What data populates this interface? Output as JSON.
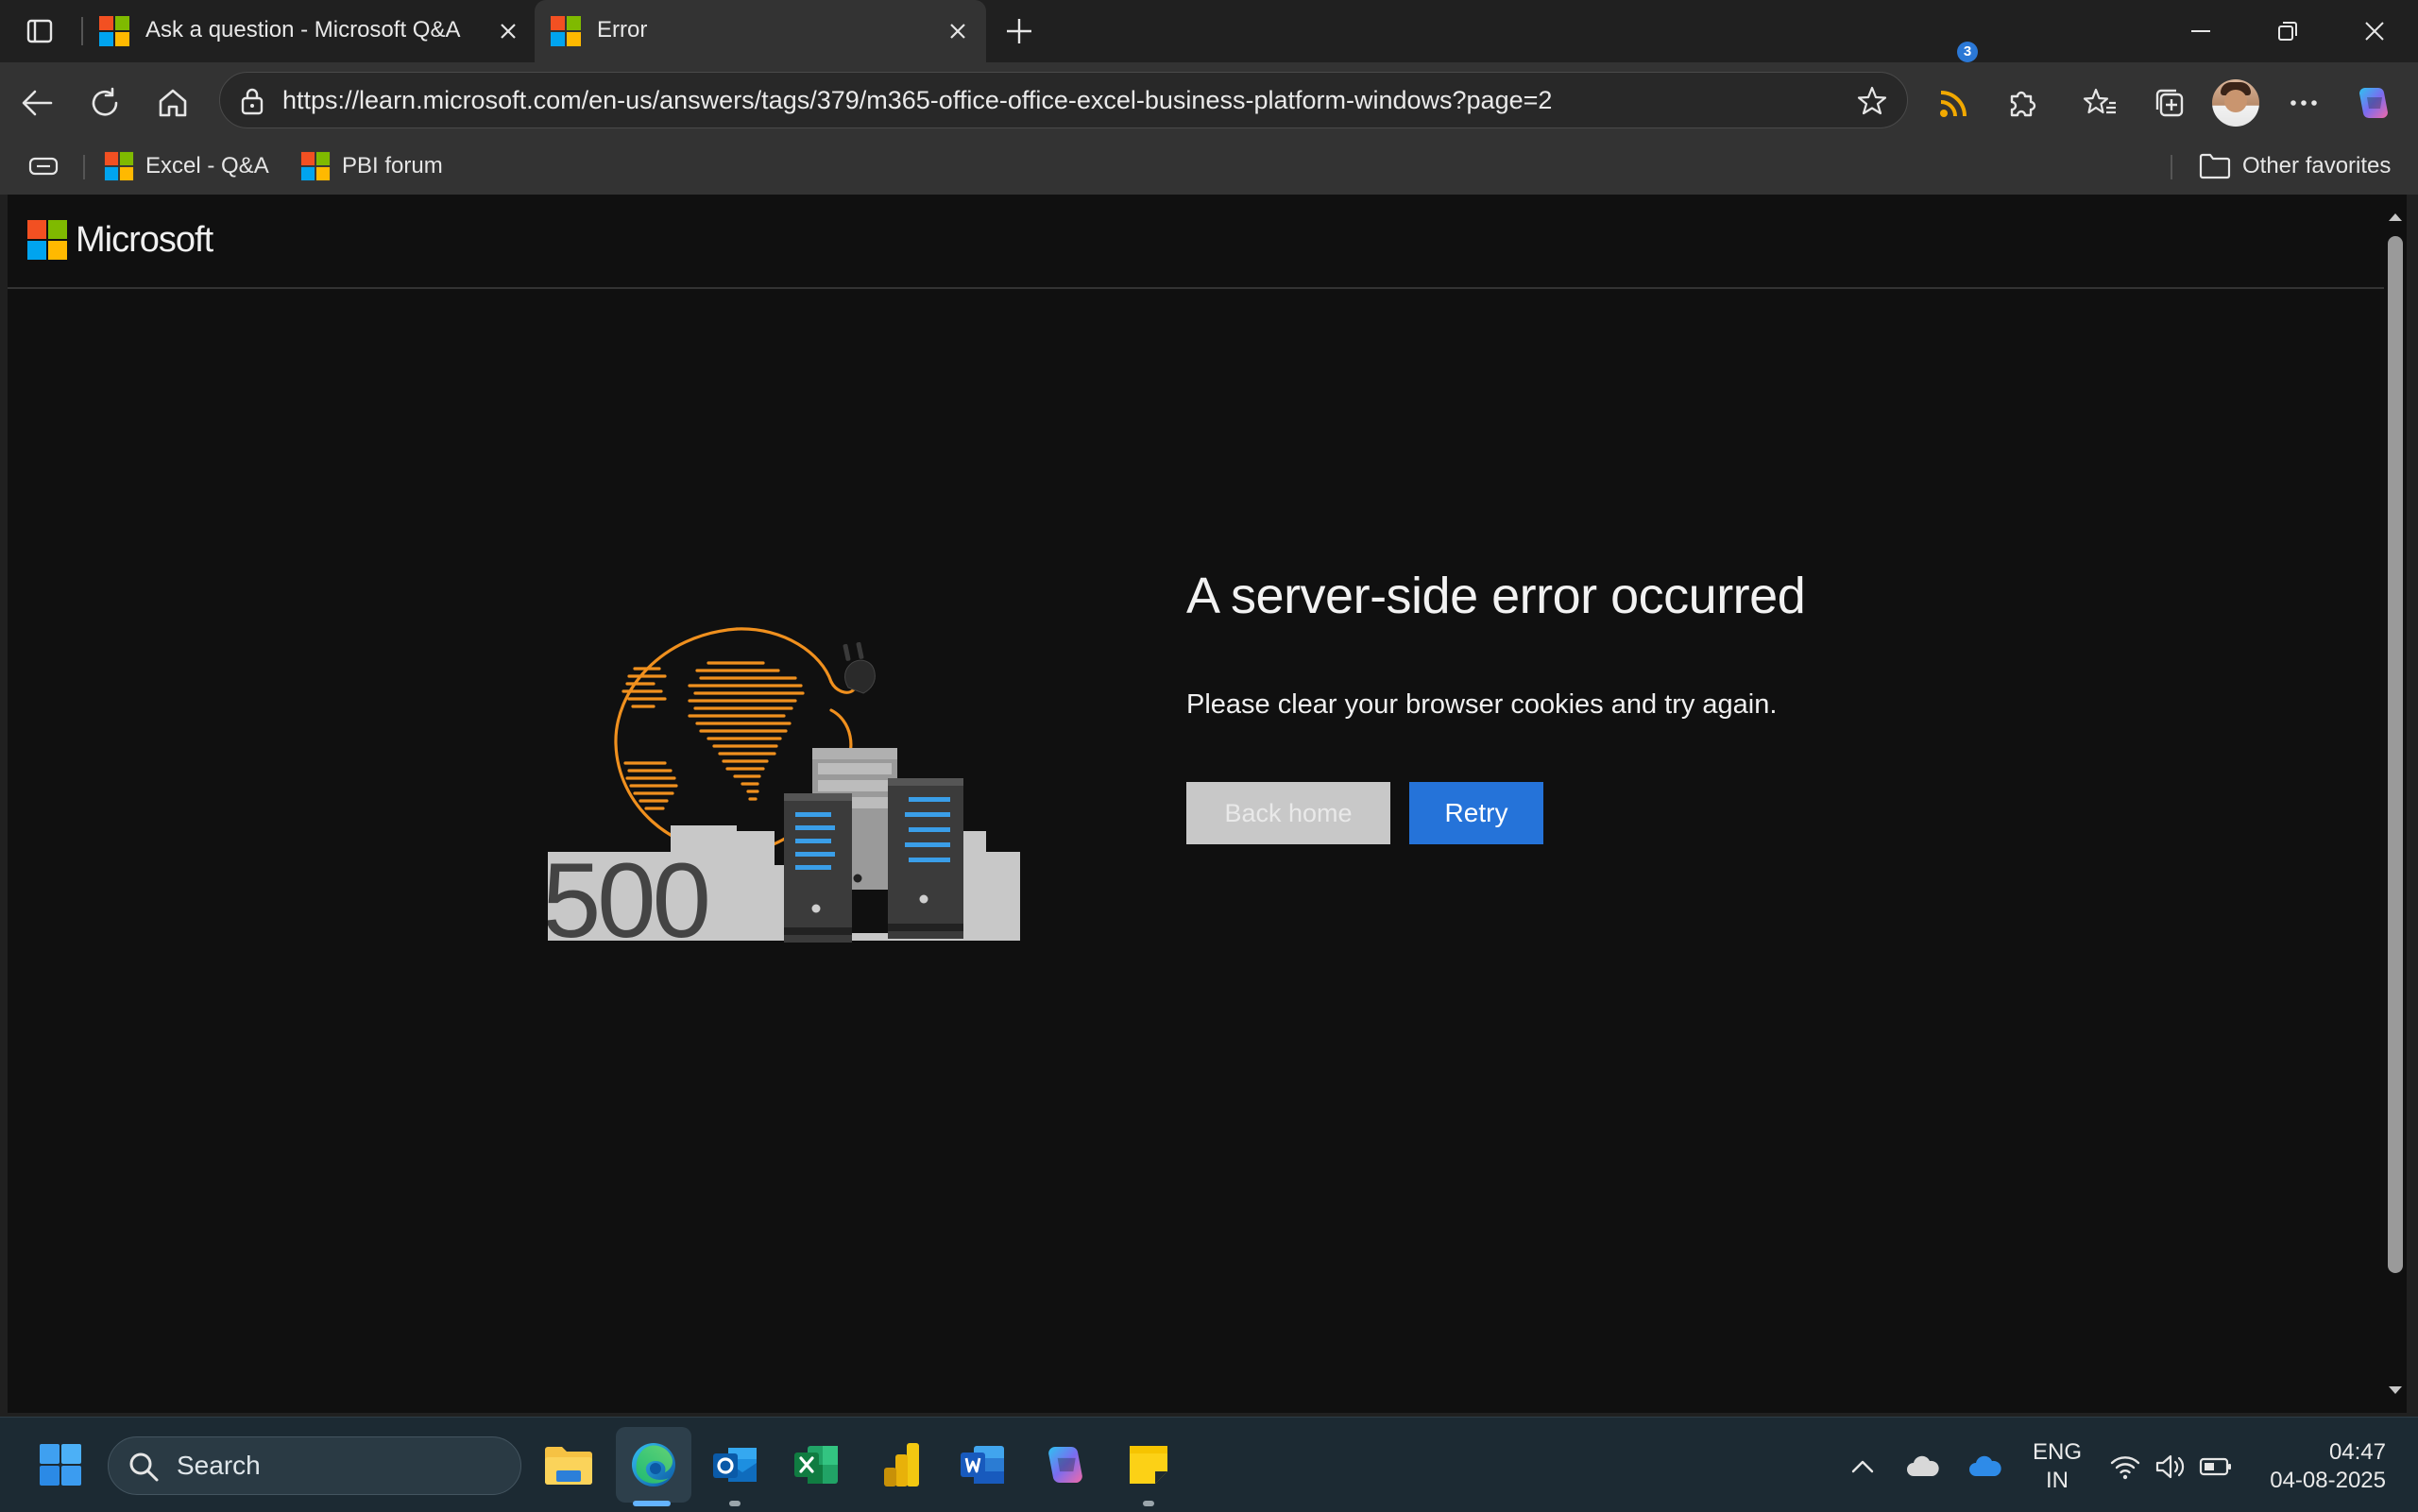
{
  "browser": {
    "tabs": [
      {
        "title": "Ask a question - Microsoft Q&A",
        "active": false
      },
      {
        "title": "Error",
        "active": true
      }
    ],
    "address_url": "https://learn.microsoft.com/en-us/answers/tags/379/m365-office-office-excel-business-platform-windows?page=2",
    "feed_badge_count": "3",
    "favorites": [
      {
        "label": "Excel - Q&A"
      },
      {
        "label": "PBI forum"
      }
    ],
    "other_favorites": "Other favorites"
  },
  "page": {
    "brand": "Microsoft",
    "illustration_code": "500",
    "title": "A server-side error occurred",
    "message": "Please clear your browser cookies and try again.",
    "back_home_label": "Back home",
    "retry_label": "Retry"
  },
  "taskbar": {
    "search_label": "Search",
    "lang_line1": "ENG",
    "lang_line2": "IN",
    "time": "04:47",
    "date": "04-08-2025"
  },
  "colors": {
    "accent_blue": "#2573d9",
    "illustration_orange": "#f0901e",
    "server_blue": "#3a9ee8"
  }
}
